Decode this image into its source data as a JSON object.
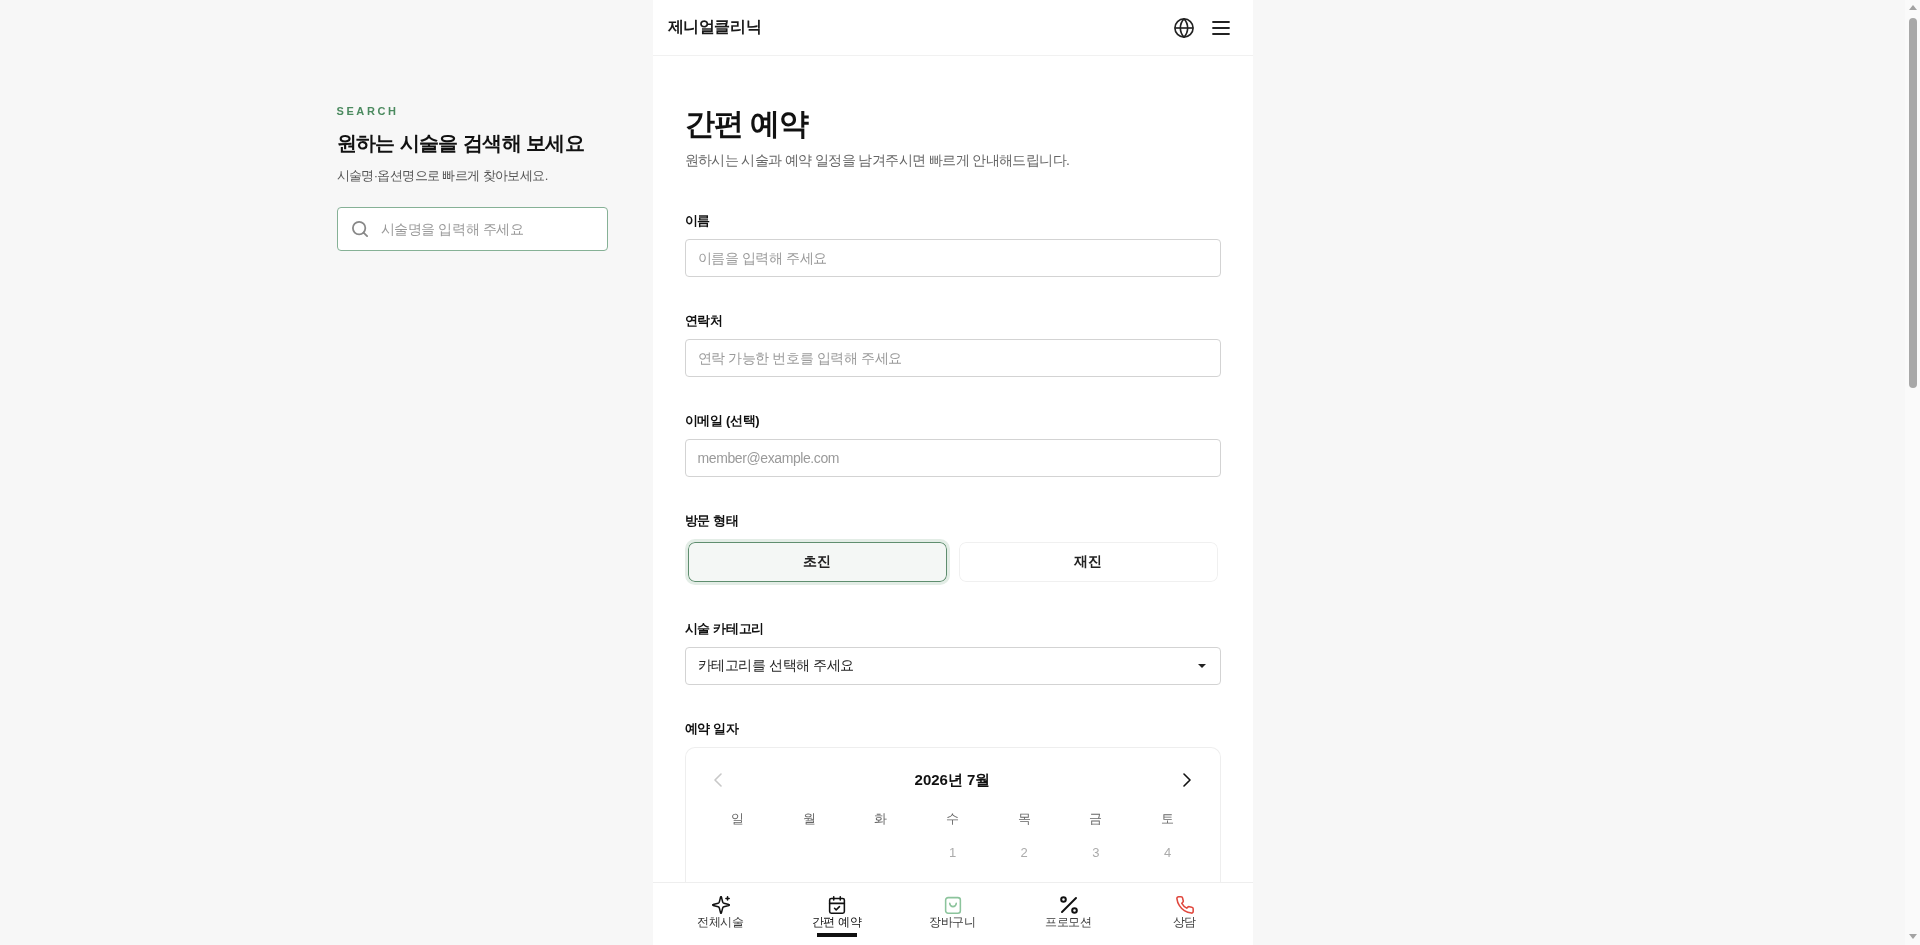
{
  "search_panel": {
    "eyebrow": "SEARCH",
    "title": "원하는 시술을 검색해 보세요",
    "subtitle": "시술명·옵션명으로 빠르게 찾아보세요.",
    "search": {
      "placeholder": "시술명을 입력해 주세요"
    }
  },
  "header": {
    "title": "제니얼클리닉"
  },
  "booking": {
    "title": "간편 예약",
    "subtitle": "원하시는 시술과 예약 일정을 남겨주시면 빠르게 안내해드립니다.",
    "fields": [
      {
        "kind": "text",
        "label": "이름",
        "placeholder": "이름을 입력해 주세요"
      },
      {
        "kind": "text",
        "label": "연락처",
        "placeholder": "연락 가능한 번호를 입력해 주세요"
      },
      {
        "kind": "text",
        "label": "이메일 (선택)",
        "placeholder": "member@example.com"
      },
      {
        "kind": "choice",
        "label": "방문 형태",
        "options": [
          {
            "label": "초진",
            "selected": true
          },
          {
            "label": "재진",
            "selected": false
          }
        ]
      },
      {
        "kind": "select",
        "label": "시술 카테고리",
        "value": "카테고리를 선택해 주세요"
      },
      {
        "kind": "calendar",
        "label": "예약 일자",
        "calendar": {
          "month": "2026년 7월",
          "prev": {
            "disabled": true
          },
          "next": {
            "disabled": false
          },
          "weekdays": [
            "일",
            "월",
            "화",
            "수",
            "목",
            "금",
            "토"
          ],
          "weeks": [
            [
              {
                "kind": "blank"
              },
              {
                "kind": "blank"
              },
              {
                "kind": "blank"
              },
              {
                "kind": "day",
                "label": "1",
                "disabled": true
              },
              {
                "kind": "day",
                "label": "2",
                "disabled": true
              },
              {
                "kind": "day",
                "label": "3",
                "disabled": true
              },
              {
                "kind": "day",
                "label": "4",
                "disabled": true
              }
            ]
          ]
        }
      }
    ]
  },
  "bottom_nav": {
    "items": [
      {
        "label": "전체시술",
        "selected": false,
        "color": "#111111"
      },
      {
        "label": "간편 예약",
        "selected": true,
        "color": "#111111"
      },
      {
        "label": "장바구니",
        "selected": false,
        "color": "#8cc49c"
      },
      {
        "label": "프로모션",
        "selected": false,
        "color": "#111111"
      },
      {
        "label": "상담",
        "selected": false,
        "color": "#e0483e"
      }
    ]
  }
}
